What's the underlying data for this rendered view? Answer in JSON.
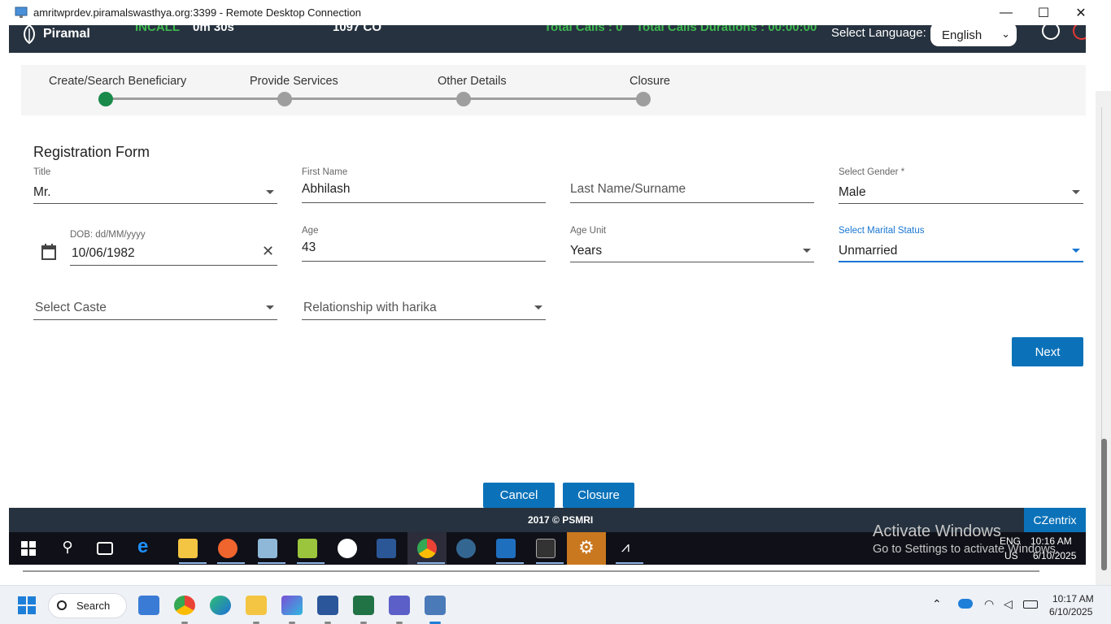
{
  "window": {
    "title": "amritwprdev.piramalswasthya.org:3399 - Remote Desktop Connection",
    "minimize": "—",
    "maximize": "☐",
    "close": "✕"
  },
  "header": {
    "logo_text": "Piramal",
    "call_status": "INCALL",
    "call_time": "0m 30s",
    "campaign": "1097 CO",
    "total_calls": "Total Calls : 0",
    "total_duration": "Total Calls Durations : 00:00:00",
    "language_label": "Select Language:",
    "language_value": "English"
  },
  "stepper": {
    "steps": [
      {
        "label": "Create/Search Beneficiary",
        "active": true
      },
      {
        "label": "Provide Services",
        "active": false
      },
      {
        "label": "Other Details",
        "active": false
      },
      {
        "label": "Closure",
        "active": false
      }
    ]
  },
  "form": {
    "title": "Registration Form",
    "title_field": {
      "label": "Title",
      "value": "Mr."
    },
    "first_name": {
      "label": "First Name",
      "value": "Abhilash"
    },
    "last_name": {
      "placeholder": "Last Name/Surname"
    },
    "gender": {
      "label": "Select Gender *",
      "value": "Male"
    },
    "dob": {
      "label": "DOB: dd/MM/yyyy",
      "value": "10/06/1982"
    },
    "age": {
      "label": "Age",
      "value": "43"
    },
    "age_unit": {
      "label": "Age Unit",
      "value": "Years"
    },
    "marital_status": {
      "label": "Select Marital Status",
      "value": "Unmarried"
    },
    "caste": {
      "placeholder": "Select Caste"
    },
    "relationship": {
      "placeholder": "Relationship with harika"
    },
    "next_label": "Next",
    "cancel_label": "Cancel",
    "closure_label": "Closure"
  },
  "footer": {
    "copyright": "2017 © PSMRI",
    "brand": "CZentrix"
  },
  "watermark": {
    "line1": "Activate Windows",
    "line2": "Go to Settings to activate Windows."
  },
  "remote_tray": {
    "lang": "ENG",
    "region": "US",
    "time": "10:16 AM",
    "date": "6/10/2025"
  },
  "host_taskbar": {
    "search_label": "Search",
    "time": "10:17 AM",
    "date": "6/10/2025"
  },
  "colors": {
    "header_bg": "#26323f",
    "accent_green": "#3fb950",
    "step_active": "#1a8a4a",
    "primary_button": "#0b72b9",
    "focus_blue": "#1976d2"
  }
}
